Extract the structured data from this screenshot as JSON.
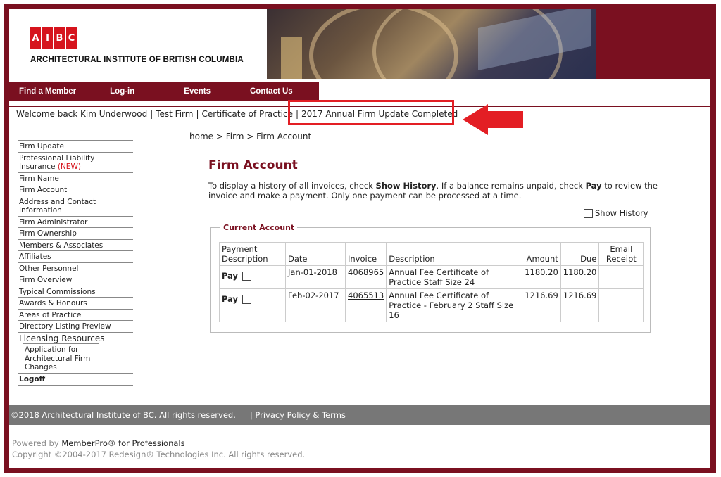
{
  "header": {
    "logo_letters": [
      "A",
      "I",
      "B",
      "C"
    ],
    "org_name": "ARCHITECTURAL INSTITUTE OF BRITISH COLUMBIA"
  },
  "nav": {
    "items": [
      {
        "label": "Find a Member"
      },
      {
        "label": "Log-in"
      },
      {
        "label": "Events"
      },
      {
        "label": "Contact Us"
      }
    ]
  },
  "welcome": {
    "greeting": "Welcome back Kim Underwood",
    "firm": "Test Firm",
    "certificate": "Certificate of Practice",
    "status": "2017 Annual Firm Update Completed"
  },
  "sidebar": {
    "items": [
      {
        "label": "Firm Update"
      },
      {
        "label": "Professional Liability Insurance",
        "badge": "(NEW)"
      },
      {
        "label": "Firm Name"
      },
      {
        "label": "Firm Account"
      },
      {
        "label": "Address and Contact Information"
      },
      {
        "label": "Firm Administrator"
      },
      {
        "label": "Firm Ownership"
      },
      {
        "label": "Members & Associates"
      },
      {
        "label": "Affiliates"
      },
      {
        "label": "Other Personnel"
      },
      {
        "label": "Firm Overview"
      },
      {
        "label": "Typical Commissions"
      },
      {
        "label": "Awards & Honours"
      },
      {
        "label": "Areas of Practice"
      },
      {
        "label": "Directory Listing Preview"
      }
    ],
    "section_label": "Licensing Resources",
    "sub_item": "Application for Architectural Firm Changes",
    "logoff": "Logoff"
  },
  "main": {
    "breadcrumb": "home > Firm > Firm Account",
    "title": "Firm Account",
    "instr_part1": "To display a history of all invoices, check ",
    "instr_bold1": "Show History",
    "instr_part2": ". If a balance remains unpaid, check ",
    "instr_bold2": "Pay",
    "instr_part3": " to review the invoice and make a payment. Only one payment can be processed at a time.",
    "show_history_label": "Show History",
    "legend": "Current Account",
    "columns": {
      "payment": "Payment Description",
      "date": "Date",
      "invoice": "Invoice",
      "description": "Description",
      "amount": "Amount",
      "due": "Due",
      "email": "Email Receipt"
    },
    "pay_label": "Pay",
    "rows": [
      {
        "date": "Jan-01-2018",
        "invoice": "4068965",
        "description": "Annual Fee Certificate of Practice Staff Size 24",
        "amount": "1180.20",
        "due": "1180.20"
      },
      {
        "date": "Feb-02-2017",
        "invoice": "4065513",
        "description": "Annual Fee Certificate of Practice - February 2 Staff Size 16",
        "amount": "1216.69",
        "due": "1216.69"
      }
    ]
  },
  "footer": {
    "copyright_bar": "©2018 Architectural Institute of BC. All rights reserved.",
    "privacy": "| Privacy Policy & Terms",
    "powered_prefix": "Powered by ",
    "powered_product": "MemberPro® for Professionals",
    "vendor_copyright": "Copyright ©2004-2017 Redesign® Technologies Inc. All rights reserved."
  },
  "colors": {
    "brand": "#7a1020",
    "logo_red": "#d6141d",
    "highlight": "#e31e24",
    "footer_bar": "#777777"
  }
}
